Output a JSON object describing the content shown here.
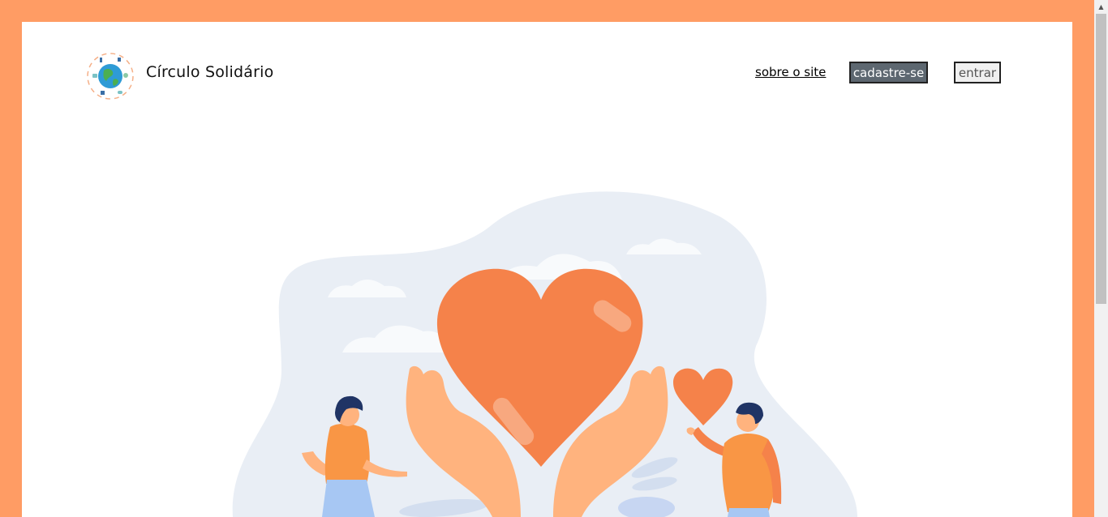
{
  "header": {
    "brand_name": "Círculo Solidário",
    "logo_icon": "globe-recycle-icon",
    "nav": {
      "about_label": "sobre o site",
      "signup_label": "cadastre-se",
      "login_label": "entrar"
    }
  },
  "hero": {
    "illustration": "hands-holding-heart-illustration"
  },
  "colors": {
    "frame": "#FF9C64",
    "page_bg": "#FFFFFF",
    "signup_button_bg": "#5D6770",
    "heart": "#F5824A",
    "blob": "#E9EEF5"
  }
}
